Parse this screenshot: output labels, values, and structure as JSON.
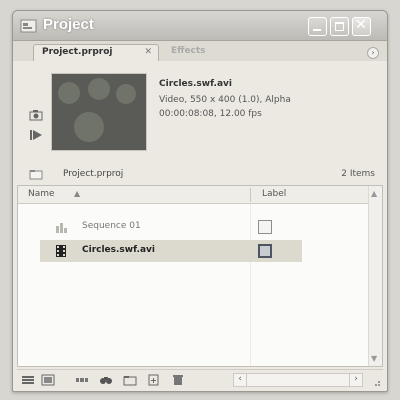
{
  "window": {
    "title": "Project",
    "title_color": "#ffffff",
    "buttons": {
      "minimize_icon": "minimize-icon",
      "maximize_icon": "maximize-icon",
      "close_glyph": "✕"
    }
  },
  "tabs": [
    {
      "label": "Project.prproj",
      "active": true,
      "close_glyph": "✕"
    },
    {
      "label": "Effects",
      "active": false
    }
  ],
  "panel_menu_glyph": "›",
  "preview": {
    "clip_name": "Circles.swf.avi",
    "info_line1": "Video, 550 x 400 (1.0), Alpha",
    "info_line2": "00:00:08:08, 12.00 fps"
  },
  "bin": {
    "name": "Project.prproj",
    "item_count": "2 Items"
  },
  "columns": {
    "name": "Name",
    "sort_glyph": "▲",
    "label": "Label"
  },
  "items": [
    {
      "name": "Sequence 01",
      "icon": "sequence-icon",
      "selected": false
    },
    {
      "name": "Circles.swf.avi",
      "icon": "film-icon",
      "selected": true
    }
  ],
  "scroll": {
    "up": "▲",
    "down": "▼",
    "left": "‹",
    "right": "›"
  },
  "colors": {
    "selection": "#dcdacf",
    "titlebar": "#c9c7c2",
    "panel": "#ece9e2"
  }
}
